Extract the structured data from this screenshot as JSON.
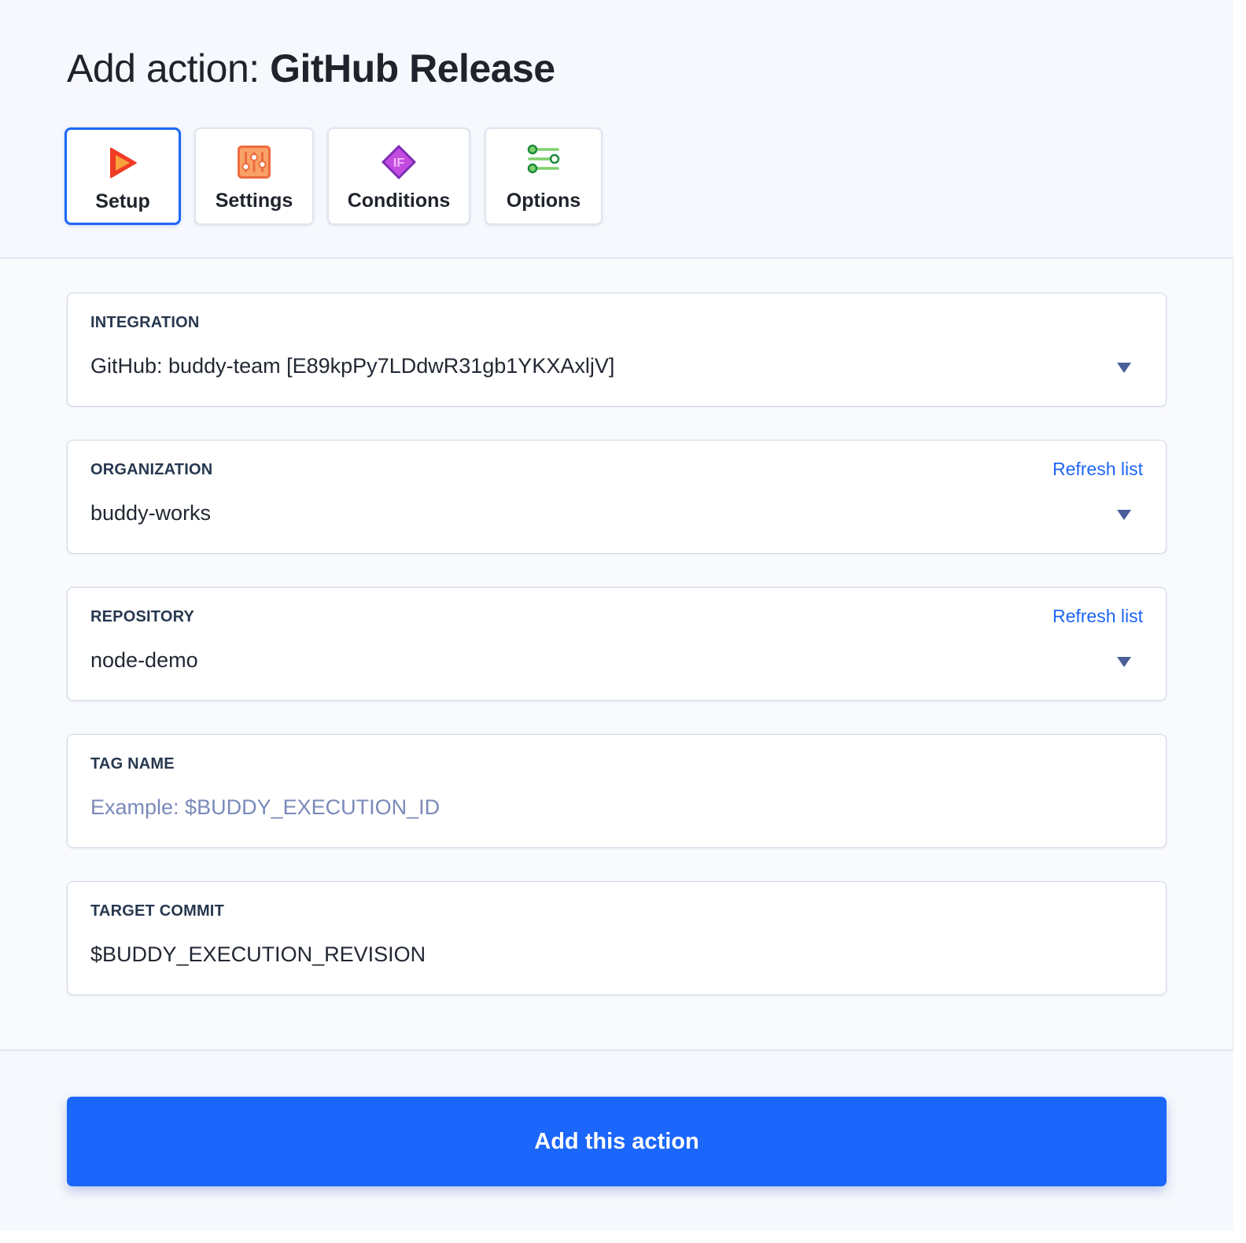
{
  "header": {
    "title_prefix": "Add action: ",
    "title_name": "GitHub Release"
  },
  "tabs": [
    {
      "label": "Setup",
      "icon": "play-icon",
      "active": true
    },
    {
      "label": "Settings",
      "icon": "sliders-icon",
      "active": false
    },
    {
      "label": "Conditions",
      "icon": "if-diamond-icon",
      "active": false
    },
    {
      "label": "Options",
      "icon": "options-toggle-icon",
      "active": false
    }
  ],
  "fields": {
    "integration": {
      "label": "INTEGRATION",
      "value": "GitHub: buddy-team [E89kpPy7LDdwR31gb1YKXAxljV]"
    },
    "organization": {
      "label": "ORGANIZATION",
      "value": "buddy-works",
      "refresh": "Refresh list"
    },
    "repository": {
      "label": "REPOSITORY",
      "value": "node-demo",
      "refresh": "Refresh list"
    },
    "tag_name": {
      "label": "TAG NAME",
      "value": "",
      "placeholder": "Example: $BUDDY_EXECUTION_ID"
    },
    "target_commit": {
      "label": "TARGET COMMIT",
      "value": "$BUDDY_EXECUTION_REVISION"
    }
  },
  "footer": {
    "submit_label": "Add this action"
  },
  "colors": {
    "accent": "#1e66f5",
    "button": "#1b66fb",
    "placeholder": "#7a89ba"
  }
}
